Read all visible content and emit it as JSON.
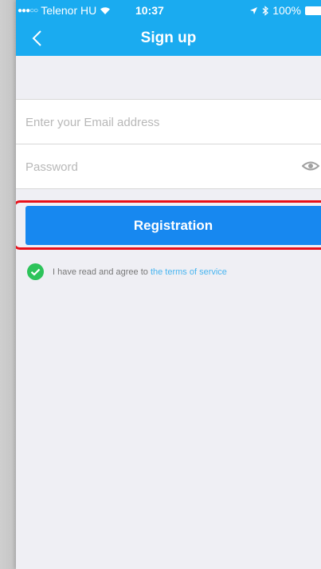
{
  "status_bar": {
    "carrier": "Telenor HU",
    "time": "10:37",
    "battery": "100%"
  },
  "nav": {
    "title": "Sign up"
  },
  "form": {
    "email_placeholder": "Enter your Email address",
    "password_placeholder": "Password",
    "register_label": "Registration"
  },
  "agreement": {
    "text": "I have read and agree to",
    "link": "the terms of service",
    "checked": true
  },
  "colors": {
    "header": "#1aabf0",
    "button": "#1788f0",
    "highlight": "#e8101a",
    "check": "#2dc35a",
    "link": "#49b5f0"
  }
}
